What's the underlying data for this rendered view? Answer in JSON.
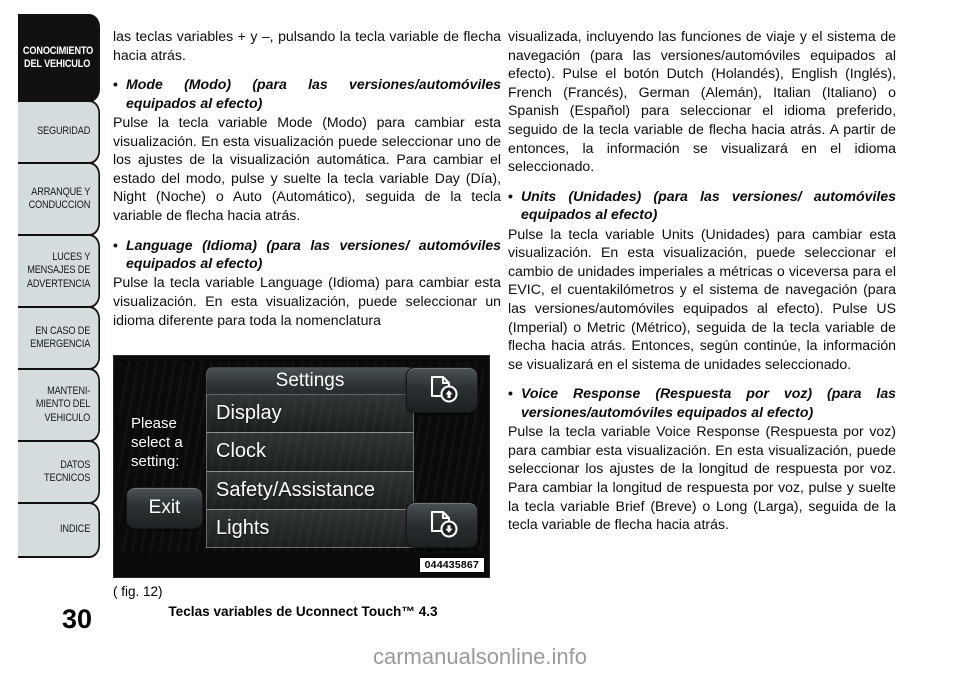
{
  "sidebar": {
    "items": [
      {
        "label": "CONOCIMIENTO DEL VEHICULO",
        "active": true
      },
      {
        "label": "SEGURIDAD",
        "active": false
      },
      {
        "label": "ARRANQUE Y CONDUCCION",
        "active": false
      },
      {
        "label": "LUCES Y MENSAJES DE ADVERTENCIA",
        "active": false
      },
      {
        "label": "EN CASO DE EMERGENCIA",
        "active": false
      },
      {
        "label": "MANTENI- MIENTO DEL VEHICULO",
        "active": false
      },
      {
        "label": "DATOS TECNICOS",
        "active": false
      },
      {
        "label": "INDICE",
        "active": false
      }
    ]
  },
  "page": {
    "number": "30",
    "watermark": "carmanualsonline.info"
  },
  "left_column": {
    "intro": "las teclas variables + y –, pulsando la tecla variable de flecha hacia atrás.",
    "bullets": [
      {
        "marker": "•",
        "heading": "Mode (Modo) (para las versiones/automóviles equipados al efecto)",
        "body": "Pulse la tecla variable Mode (Modo) para cambiar esta visualización. En esta visualización puede seleccionar uno de los ajustes de la visualización automática. Para cambiar el estado del modo, pulse y suelte la tecla variable Day (Día), Night (Noche) o Auto (Automático), seguida de la tecla variable de flecha hacia atrás."
      },
      {
        "marker": "•",
        "heading": "Language (Idioma) (para las versiones/ automóviles equipados al efecto)",
        "body": "Pulse la tecla variable Language (Idioma) para cambiar esta visualización. En esta visualización, puede seleccionar un idioma diferente para toda la nomenclatura"
      }
    ]
  },
  "right_column": {
    "intro": "visualizada, incluyendo las funciones de viaje y el sistema de navegación (para las versiones/automóviles equipados al efecto). Pulse el botón Dutch (Holandés), English (Inglés), French (Francés), German (Alemán), Italian (Italiano) o Spanish (Español) para seleccionar el idioma preferido, seguido de la tecla variable de flecha hacia atrás. A partir de entonces, la información se visualizará en el idioma seleccionado.",
    "bullets": [
      {
        "marker": "•",
        "heading": "Units (Unidades) (para las versiones/ automóviles equipados al efecto)",
        "body": "Pulse la tecla variable Units (Unidades) para cambiar esta visualización. En esta visualización, puede seleccionar el cambio de unidades imperiales a métricas o viceversa para el EVIC, el cuentakilómetros y el sistema de navegación (para las versiones/automóviles equipados al efecto). Pulse US (Imperial) o Metric (Métrico), seguida de la tecla variable de flecha hacia atrás. Entonces, según continúe, la información se visualizará en el sistema de unidades seleccionado."
      },
      {
        "marker": "•",
        "heading": "Voice Response (Respuesta por voz) (para las versiones/automóviles equipados al efecto)",
        "body": "Pulse la tecla variable Voice Response (Respuesta por voz) para cambiar esta visualización. En esta visualización, puede seleccionar los ajustes de la longitud de respuesta por voz. Para cambiar la longitud de respuesta por voz, pulse y suelte la tecla variable Brief (Breve) o Long (Larga), seguida de la tecla variable de flecha hacia atrás."
      }
    ]
  },
  "figure": {
    "reference": "( fig. 12)",
    "caption": "Teclas variables de Uconnect Touch™ 4.3",
    "code": "044435867",
    "screen": {
      "prompt": "Please select a setting:",
      "exit_label": "Exit",
      "menu_title": "Settings",
      "menu_items": [
        "Display",
        "Clock",
        "Safety/Assistance",
        "Lights"
      ],
      "page_up_icon": "page-up-icon",
      "page_down_icon": "page-down-icon"
    }
  }
}
